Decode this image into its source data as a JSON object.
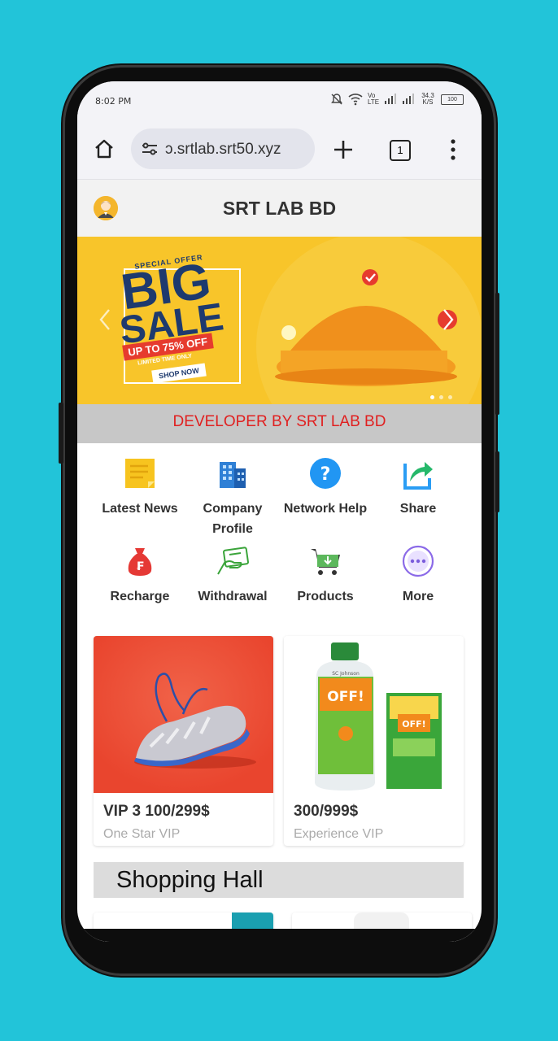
{
  "statusbar": {
    "time": "8:02 PM",
    "network": "Vo LTE",
    "speed": "34.3 K/S",
    "battery": "100"
  },
  "browser": {
    "url": "ɔ.srtlab.srt50.xyz",
    "tab_count": "1"
  },
  "app": {
    "title": "SRT LAB BD"
  },
  "banner": {
    "special": "SPECIAL OFFER",
    "big": "BIG",
    "sale": "SALE",
    "discount": "UP TO 75% OFF",
    "limited": "LIMITED TIME ONLY",
    "shop": "SHOP NOW"
  },
  "marquee": "DEVELOPER BY SRT LAB BD",
  "menu": [
    {
      "label": "Latest News",
      "icon": "news-icon"
    },
    {
      "label": "Company Profile",
      "icon": "building-icon"
    },
    {
      "label": "Network Help",
      "icon": "help-icon"
    },
    {
      "label": "Share",
      "icon": "share-icon"
    },
    {
      "label": "Recharge",
      "icon": "money-bag-icon"
    },
    {
      "label": "Withdrawal",
      "icon": "card-icon"
    },
    {
      "label": "Products",
      "icon": "cart-icon"
    },
    {
      "label": "More",
      "icon": "more-icon"
    }
  ],
  "products": [
    {
      "price": "VIP 3 100/299$",
      "tier": "One Star VIP"
    },
    {
      "price": "300/999$",
      "tier": "Experience VIP",
      "brand": "OFF!",
      "maker": "SC Johnson"
    }
  ],
  "section": {
    "title": "Shopping Hall"
  },
  "colors": {
    "background": "#22c4d9",
    "accent_red": "#e02020",
    "header_bg": "#f2f2f2"
  }
}
